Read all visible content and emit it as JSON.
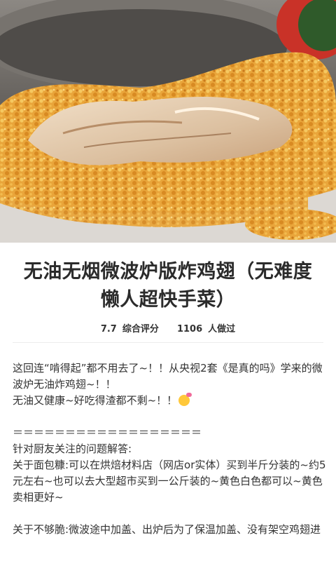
{
  "recipe": {
    "title": "无油无烟微波炉版炸鸡翅（无难度懒人超快手菜）",
    "rating_value": "7.7",
    "rating_label": "综合评分",
    "made_count": "1106",
    "made_label": "人做过"
  },
  "description": {
    "lines": [
      "这回连“啃得起”都不用去了~！！从央视2套《是真的吗》学来的微",
      "波炉无油炸鸡翅~！！",
      "无油又健康~好吃得渣都不剩~！！",
      "",
      "＝＝＝＝＝＝＝＝＝＝＝＝＝＝＝＝＝＝",
      "针对厨友关注的问题解答:",
      "关于面包糠:可以在烘焙材料店（网店or实体）买到半斤分装的~约5",
      "元左右~也可以去大型超市买到一公斤装的~黄色白色都可以~黄色",
      "卖相更好~",
      "",
      "关于不够脆:微波途中加盖、出炉后为了保温加盖、没有架空鸡翅进"
    ],
    "emoji_icon": "face-emoji-icon"
  },
  "colors": {
    "crust": "#e8a83a",
    "meat": "#e8d2b8",
    "background": "#6f6b66"
  }
}
